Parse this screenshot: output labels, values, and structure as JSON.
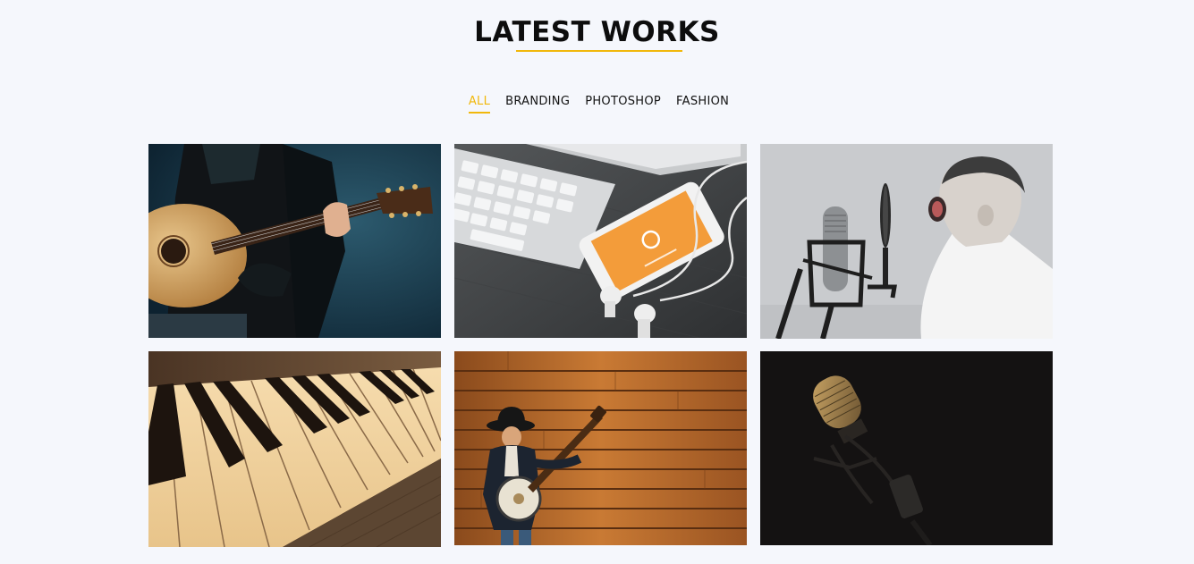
{
  "section": {
    "title": "LATEST WORKS"
  },
  "filters": [
    {
      "label": "ALL",
      "active": true
    },
    {
      "label": "BRANDING",
      "active": false
    },
    {
      "label": "PHOTOSHOP",
      "active": false
    },
    {
      "label": "FASHION",
      "active": false
    }
  ],
  "colors": {
    "accent": "#f1b80c",
    "background": "#f5f7fc"
  },
  "gallery": {
    "items": [
      {
        "icon": "guitar-player-photo"
      },
      {
        "icon": "keyboard-phone-earphones-photo"
      },
      {
        "icon": "boy-singing-microphone-photo"
      },
      {
        "icon": "piano-keys-photo"
      },
      {
        "icon": "banjo-player-wood-wall-photo"
      },
      {
        "icon": "studio-microphone-dark-photo"
      }
    ]
  }
}
